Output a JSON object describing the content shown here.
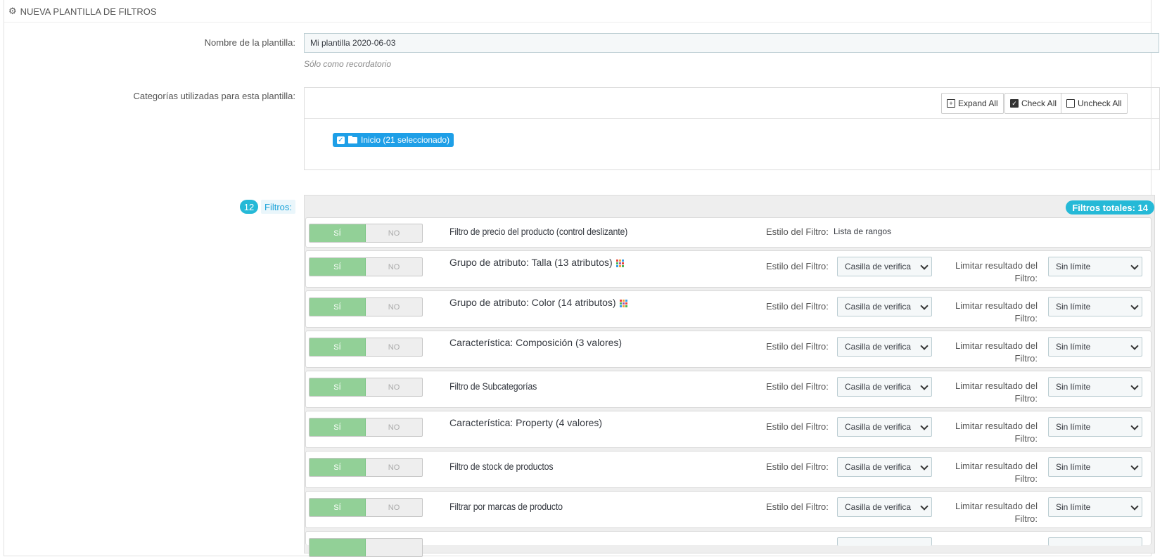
{
  "panel": {
    "title": "NUEVA PLANTILLA DE FILTROS",
    "icon": "gears-icon"
  },
  "template_name": {
    "label": "Nombre de la plantilla:",
    "value": "Mi plantilla 2020-06-03",
    "help": "Sólo como recordatorio"
  },
  "categories": {
    "label": "Categorías utilizadas para esta plantilla:",
    "expand_all": "Expand All",
    "check_all": "Check All",
    "uncheck_all": "Uncheck All",
    "root_node": "Inicio (21 seleccionado)"
  },
  "filters_header": {
    "count": "12",
    "label": "Filtros:",
    "total": "Filtros totales: 14"
  },
  "switch": {
    "yes": "SÍ",
    "no": "NO"
  },
  "style_label": "Estilo del Filtro:",
  "limit_label": "Limitar resultado del Filtro:",
  "filters": [
    {
      "name": "Filtro de precio del producto (control deslizante)",
      "style_value": "Lista de rangos"
    },
    {
      "name": "Grupo de atributo: Talla (13 atributos)",
      "style": "Casilla de verifica",
      "limit": "Sin límite"
    },
    {
      "name": "Grupo de atributo: Color (14 atributos)",
      "style": "Casilla de verifica",
      "limit": "Sin límite"
    },
    {
      "name": "Característica: Composición (3 valores)",
      "style": "Casilla de verifica",
      "limit": "Sin límite"
    },
    {
      "name": "Filtro de Subcategorías",
      "style": "Casilla de verifica",
      "limit": "Sin límite"
    },
    {
      "name": "Característica: Property (4 valores)",
      "style": "Casilla de verifica",
      "limit": "Sin límite"
    },
    {
      "name": "Filtro de stock de productos",
      "style": "Casilla de verifica",
      "limit": "Sin límite"
    },
    {
      "name": "Filtrar por marcas de producto",
      "style": "Casilla de verifica",
      "limit": "Sin límite"
    }
  ]
}
